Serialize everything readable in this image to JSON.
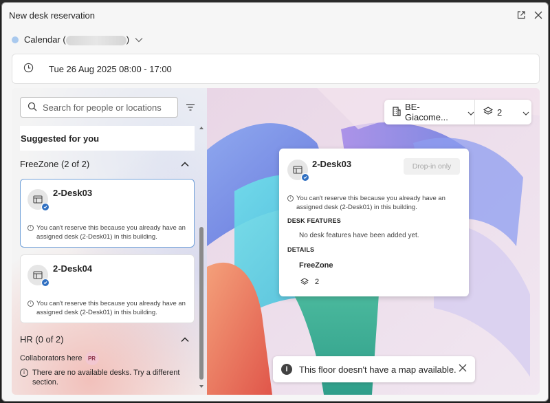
{
  "window": {
    "title": "New desk reservation"
  },
  "calendar": {
    "label_prefix": "Calendar (",
    "label_suffix": ")"
  },
  "date": {
    "text": "Tue 26 Aug 2025 08:00 - 17:00"
  },
  "search": {
    "placeholder": "Search for people or locations"
  },
  "suggested": {
    "label": "Suggested for you"
  },
  "sections": [
    {
      "label": "FreeZone (2 of 2)"
    },
    {
      "label": "HR (0 of 2)"
    }
  ],
  "desks": [
    {
      "name": "2-Desk03",
      "note": "You can't reserve this because you already have an assigned desk (2-Desk01) in this building.",
      "selected": true
    },
    {
      "name": "2-Desk04",
      "note": "You can't reserve this because you already have an assigned desk (2-Desk01) in this building.",
      "selected": false
    }
  ],
  "hr": {
    "collaborators_label": "Collaborators here",
    "collaborator_initials": "PR",
    "no_desks": "There are no available desks. Try a different section."
  },
  "building": {
    "name": "BE-Giacome...",
    "floor": "2"
  },
  "popup": {
    "name": "2-Desk03",
    "badge": "Drop-in only",
    "note": "You can't reserve this because you already have an assigned desk (2-Desk01) in this building.",
    "features_header": "DESK FEATURES",
    "features_text": "No desk features have been added yet.",
    "details_header": "DETAILS",
    "zone": "FreeZone",
    "floor": "2"
  },
  "toast": {
    "text": "This floor doesn't have a map available."
  },
  "colors": {
    "accent": "#2f6fc1",
    "selected_border": "#6f9fd8",
    "calendar_dot": "#a9c9ee"
  }
}
